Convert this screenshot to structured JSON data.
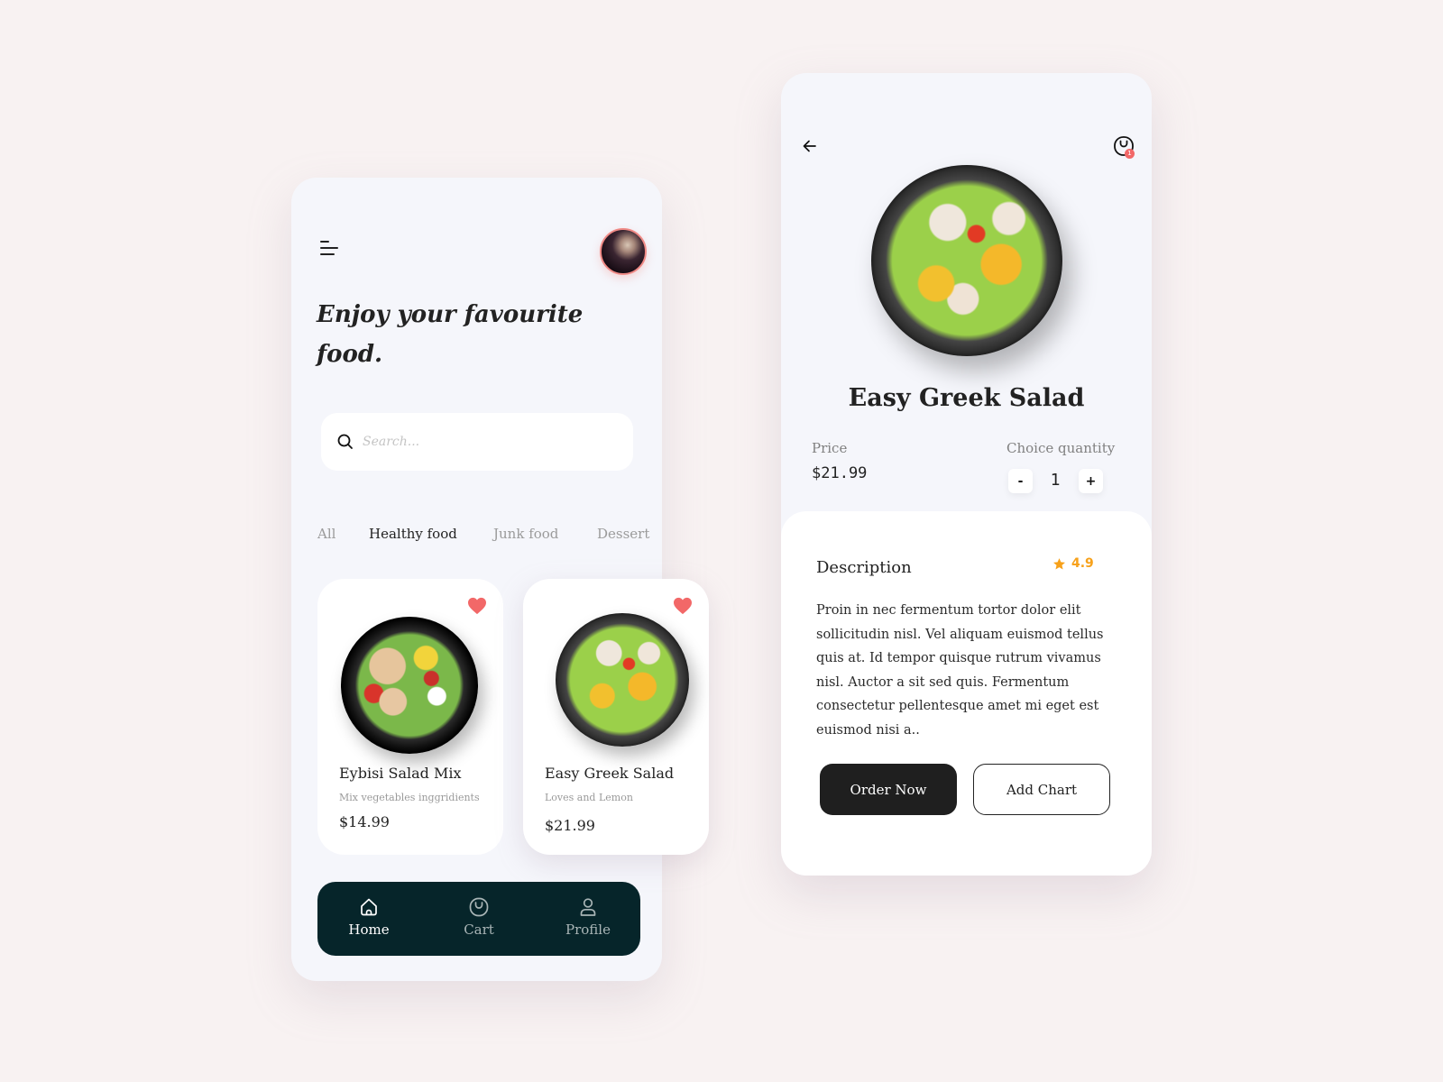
{
  "home": {
    "headline": "Enjoy your favourite food.",
    "search": {
      "placeholder": "Search...",
      "value": ""
    },
    "categories": [
      {
        "label": "All",
        "active": false
      },
      {
        "label": "Healthy food",
        "active": true
      },
      {
        "label": "Junk food",
        "active": false
      },
      {
        "label": "Dessert",
        "active": false
      }
    ],
    "products": [
      {
        "name": "Eybisi Salad Mix",
        "subtitle": "Mix vegetables inggridients",
        "price": "$14.99",
        "favorite": true
      },
      {
        "name": "Easy Greek Salad",
        "subtitle": "Loves and Lemon",
        "price": "$21.99",
        "favorite": true
      }
    ],
    "nav": [
      {
        "label": "Home",
        "icon": "home-icon",
        "active": true
      },
      {
        "label": "Cart",
        "icon": "bag-icon",
        "active": false
      },
      {
        "label": "Profile",
        "icon": "user-icon",
        "active": false
      }
    ]
  },
  "detail": {
    "title": "Easy Greek Salad",
    "cart_badge": "1",
    "price_label": "Price",
    "price": "$21.99",
    "quantity_label": "Choice quantity",
    "quantity": "1",
    "minus_label": "-",
    "plus_label": "+",
    "description_title": "Description",
    "rating": "4.9",
    "description": "Proin in nec fermentum tortor dolor elit sollicitudin nisl. Vel aliquam euismod tellus quis at. Id tempor quisque rutrum vivamus nisl. Auctor a sit sed quis. Fermentum consectetur pellentesque amet mi eget est euismod nisi a..",
    "order_button": "Order Now",
    "add_button": "Add Chart"
  },
  "colors": {
    "page_bg": "#f8f2f2",
    "card_bg": "#f5f6fb",
    "nav_bg": "#06252a",
    "heart": "#f26868",
    "rating": "#f7a11a",
    "avatar_ring": "#f08a86"
  }
}
